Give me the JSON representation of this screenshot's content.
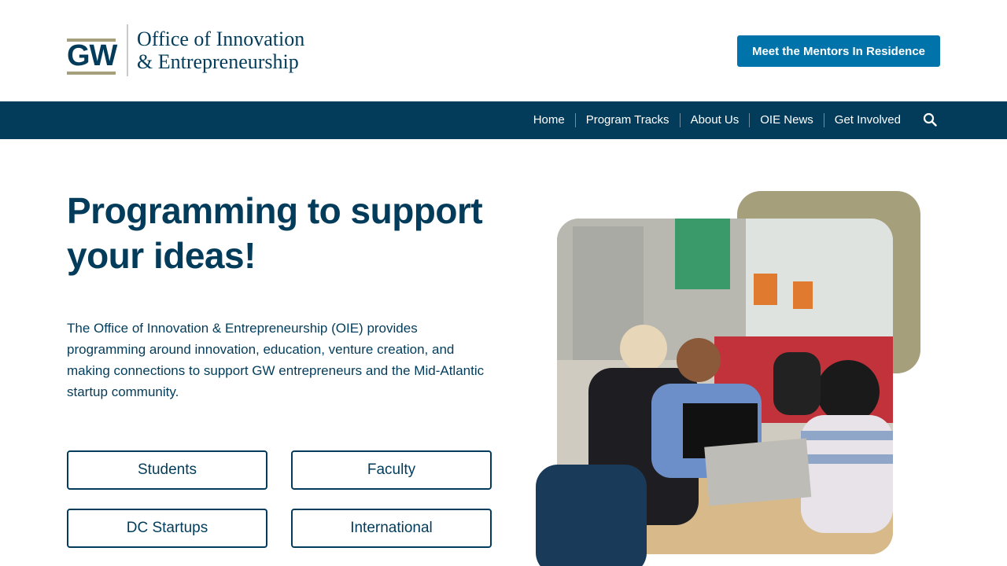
{
  "header": {
    "logo": {
      "mark": "GW",
      "line1": "Office of Innovation",
      "line2": "& Entrepreneurship"
    },
    "cta_label": "Meet the Mentors In Residence"
  },
  "nav": {
    "items": [
      {
        "label": "Home"
      },
      {
        "label": "Program Tracks"
      },
      {
        "label": "About Us"
      },
      {
        "label": "OIE News"
      },
      {
        "label": "Get Involved"
      }
    ],
    "search_icon": "search-icon"
  },
  "hero": {
    "headline_line1": "Programming to support",
    "headline_line2": "your ideas!",
    "intro": "The Office of Innovation & Entrepreneurship (OIE) provides programming around innovation, education, venture creation, and making connections to support GW entrepreneurs and the Mid-Atlantic startup community.",
    "audience_buttons": [
      {
        "label": "Students"
      },
      {
        "label": "Faculty"
      },
      {
        "label": "DC Startups"
      },
      {
        "label": "International"
      }
    ]
  },
  "colors": {
    "navy": "#033c5a",
    "cta_blue": "#0073aa",
    "tan": "#a69f7b",
    "dark_navy_block": "#1a3a5a"
  }
}
